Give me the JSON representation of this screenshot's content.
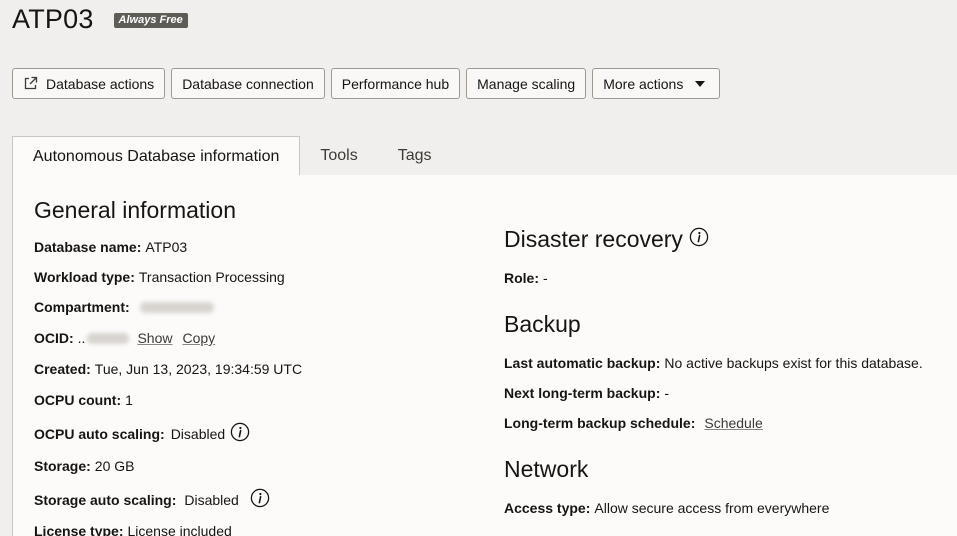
{
  "header": {
    "title": "ATP03",
    "badge": "Always Free"
  },
  "actions": {
    "database_actions": "Database actions",
    "database_connection": "Database connection",
    "performance_hub": "Performance hub",
    "manage_scaling": "Manage scaling",
    "more_actions": "More actions"
  },
  "tabs": [
    {
      "label": "Autonomous Database information"
    },
    {
      "label": "Tools"
    },
    {
      "label": "Tags"
    }
  ],
  "general": {
    "title": "General information",
    "database_name_label": "Database name:",
    "database_name": "ATP03",
    "workload_type_label": "Workload type:",
    "workload_type": "Transaction Processing",
    "compartment_label": "Compartment:",
    "ocid_label": "OCID:",
    "ocid_prefix": "..",
    "show_link": "Show",
    "copy_link": "Copy",
    "created_label": "Created:",
    "created": "Tue, Jun 13, 2023, 19:34:59 UTC",
    "ocpu_count_label": "OCPU count:",
    "ocpu_count": "1",
    "ocpu_auto_scaling_label": "OCPU auto scaling:",
    "ocpu_auto_scaling": "Disabled",
    "storage_label": "Storage:",
    "storage": "20 GB",
    "storage_auto_scaling_label": "Storage auto scaling:",
    "storage_auto_scaling": "Disabled",
    "license_type_label": "License type:",
    "license_type": "License included"
  },
  "disaster_recovery": {
    "title": "Disaster recovery",
    "role_label": "Role:",
    "role": "-"
  },
  "backup": {
    "title": "Backup",
    "last_auto_label": "Last automatic backup:",
    "last_auto": "No active backups exist for this database.",
    "next_long_term_label": "Next long-term backup:",
    "next_long_term": "-",
    "schedule_label": "Long-term backup schedule:",
    "schedule_link": "Schedule"
  },
  "network": {
    "title": "Network",
    "access_type_label": "Access type:",
    "access_type": "Allow secure access from everywhere"
  }
}
